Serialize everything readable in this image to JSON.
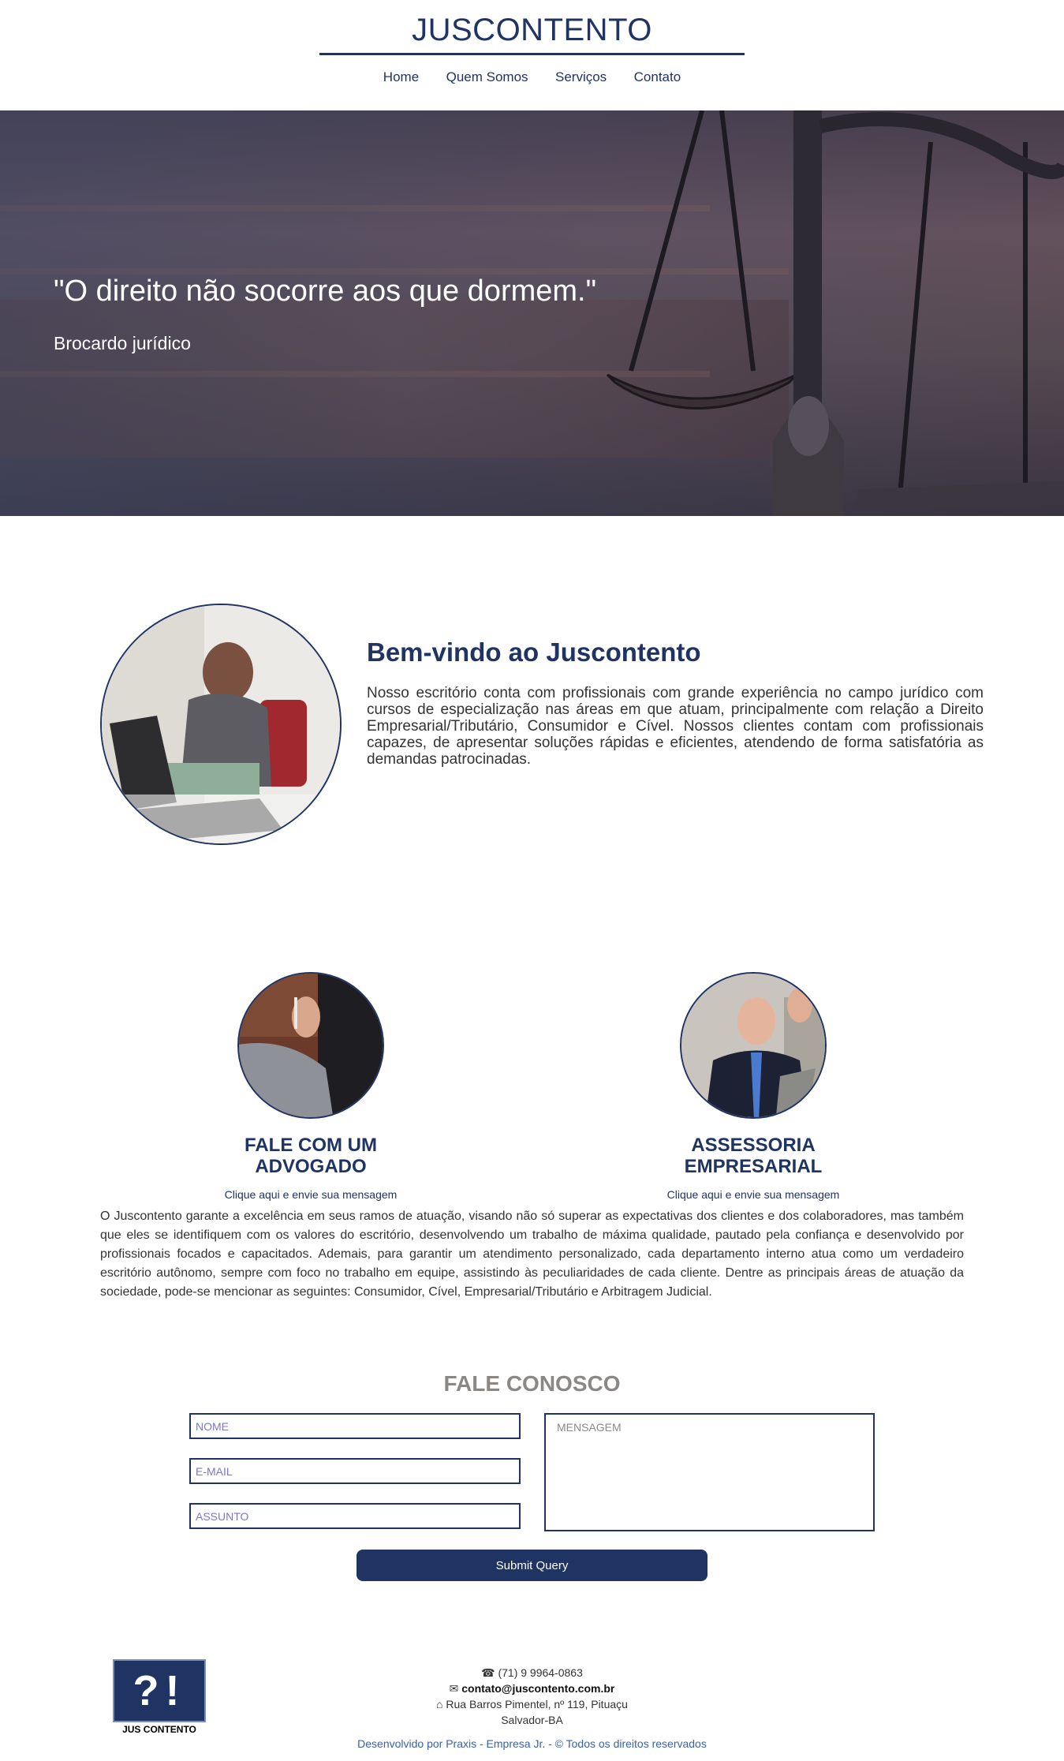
{
  "header": {
    "brand": "JUSCONTENTO",
    "nav": [
      "Home",
      "Quem Somos",
      "Serviços",
      "Contato"
    ]
  },
  "hero": {
    "quote": "\"O direito não socorre aos que dormem.\"",
    "author": "Brocardo jurídico"
  },
  "welcome": {
    "title": "Bem-vindo ao Juscontento",
    "text": "Nosso escritório conta com profissionais com grande experiência no campo jurídico com cursos de especialização nas áreas em que atuam, principalmente com relação a Direito Empresarial/Tributário, Consumidor e Cível. Nossos clientes contam com profissionais capazes, de apresentar soluções rápidas e eficientes, atendendo de forma satisfatória as demandas patrocinadas."
  },
  "services": [
    {
      "title_line1": "FALE COM UM",
      "title_line2": "ADVOGADO",
      "link": "Clique aqui e envie sua mensagem"
    },
    {
      "title_line1": "ASSESSORIA",
      "title_line2": "EMPRESARIAL",
      "link": "Clique aqui e envie sua mensagem"
    }
  ],
  "about": {
    "text": "O Juscontento garante a excelência em seus ramos de atuação, visando não só superar as expectativas dos clientes e dos colaboradores, mas também que eles se identifiquem com os valores do escritório, desenvolvendo um trabalho de máxima qualidade, pautado pela confiança e desenvolvido por profissionais focados e capacitados. Ademais, para garantir um atendimento personalizado, cada departamento interno atua como um verdadeiro escritório autônomo, sempre com foco no trabalho em equipe, assistindo às peculiaridades de cada cliente. Dentre as principais áreas de atuação da sociedade, pode-se mencionar as seguintes: Consumidor, Cível, Empresarial/Tributário e Arbitragem Judicial."
  },
  "contact": {
    "title": "FALE CONOSCO",
    "name_placeholder": "NOME",
    "email_placeholder": "E-MAIL",
    "subject_placeholder": "ASSUNTO",
    "message_placeholder": "MENSAGEM",
    "submit_label": "Submit Query"
  },
  "footer": {
    "logo_symbols": "?!",
    "logo_text": "JUS CONTENTO",
    "phone_icon": "☎",
    "phone": "(71) 9 9964-0863",
    "email_icon": "✉",
    "email": "contato@juscontento.com.br",
    "address_icon": "⌂",
    "address": "Rua Barros Pimentel, nº 119, Pituaçu",
    "city": "Salvador-BA",
    "credits": "Desenvolvido por Praxis - Empresa Jr. - © Todos os direitos reservados"
  }
}
